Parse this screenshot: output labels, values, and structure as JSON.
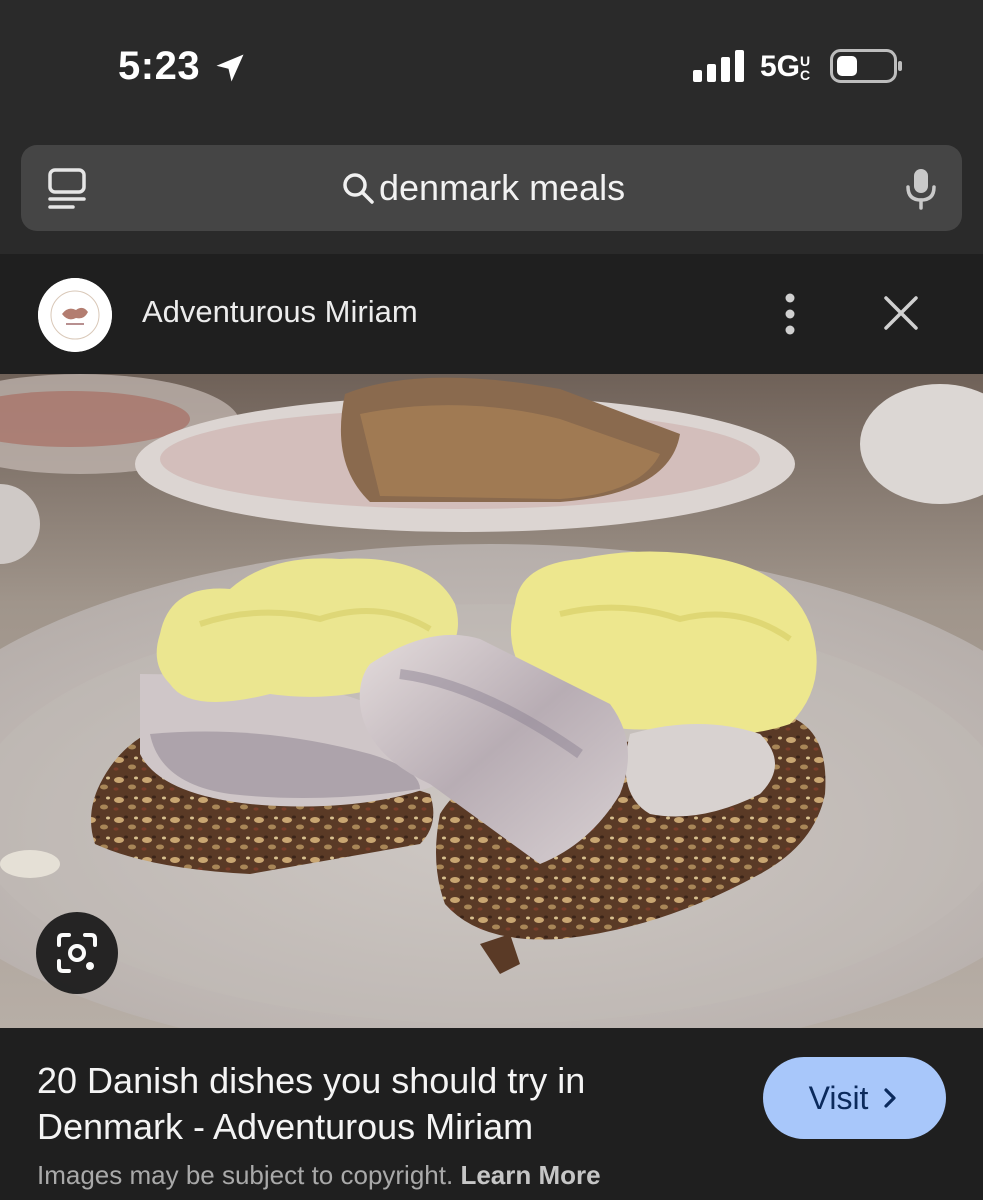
{
  "status_bar": {
    "time": "5:23",
    "network": "5G",
    "network_suffix": "UC",
    "icons": [
      "location-arrow-icon",
      "signal-bars-icon",
      "battery-icon"
    ]
  },
  "search": {
    "query": "denmark meals",
    "icons": [
      "tabs-icon",
      "search-icon",
      "mic-icon"
    ]
  },
  "source": {
    "name": "Adventurous Miriam",
    "icons": [
      "more-vertical-icon",
      "close-icon"
    ]
  },
  "result": {
    "title": "20 Danish dishes you should try in Denmark - Adventurous Miriam",
    "visit_label": "Visit",
    "copyright_text": "Images may be subject to copyright.",
    "learn_more_label": "Learn More"
  },
  "colors": {
    "accent_button": "#a8c7fa",
    "background": "#1f1f1f",
    "search_box": "#454545"
  }
}
